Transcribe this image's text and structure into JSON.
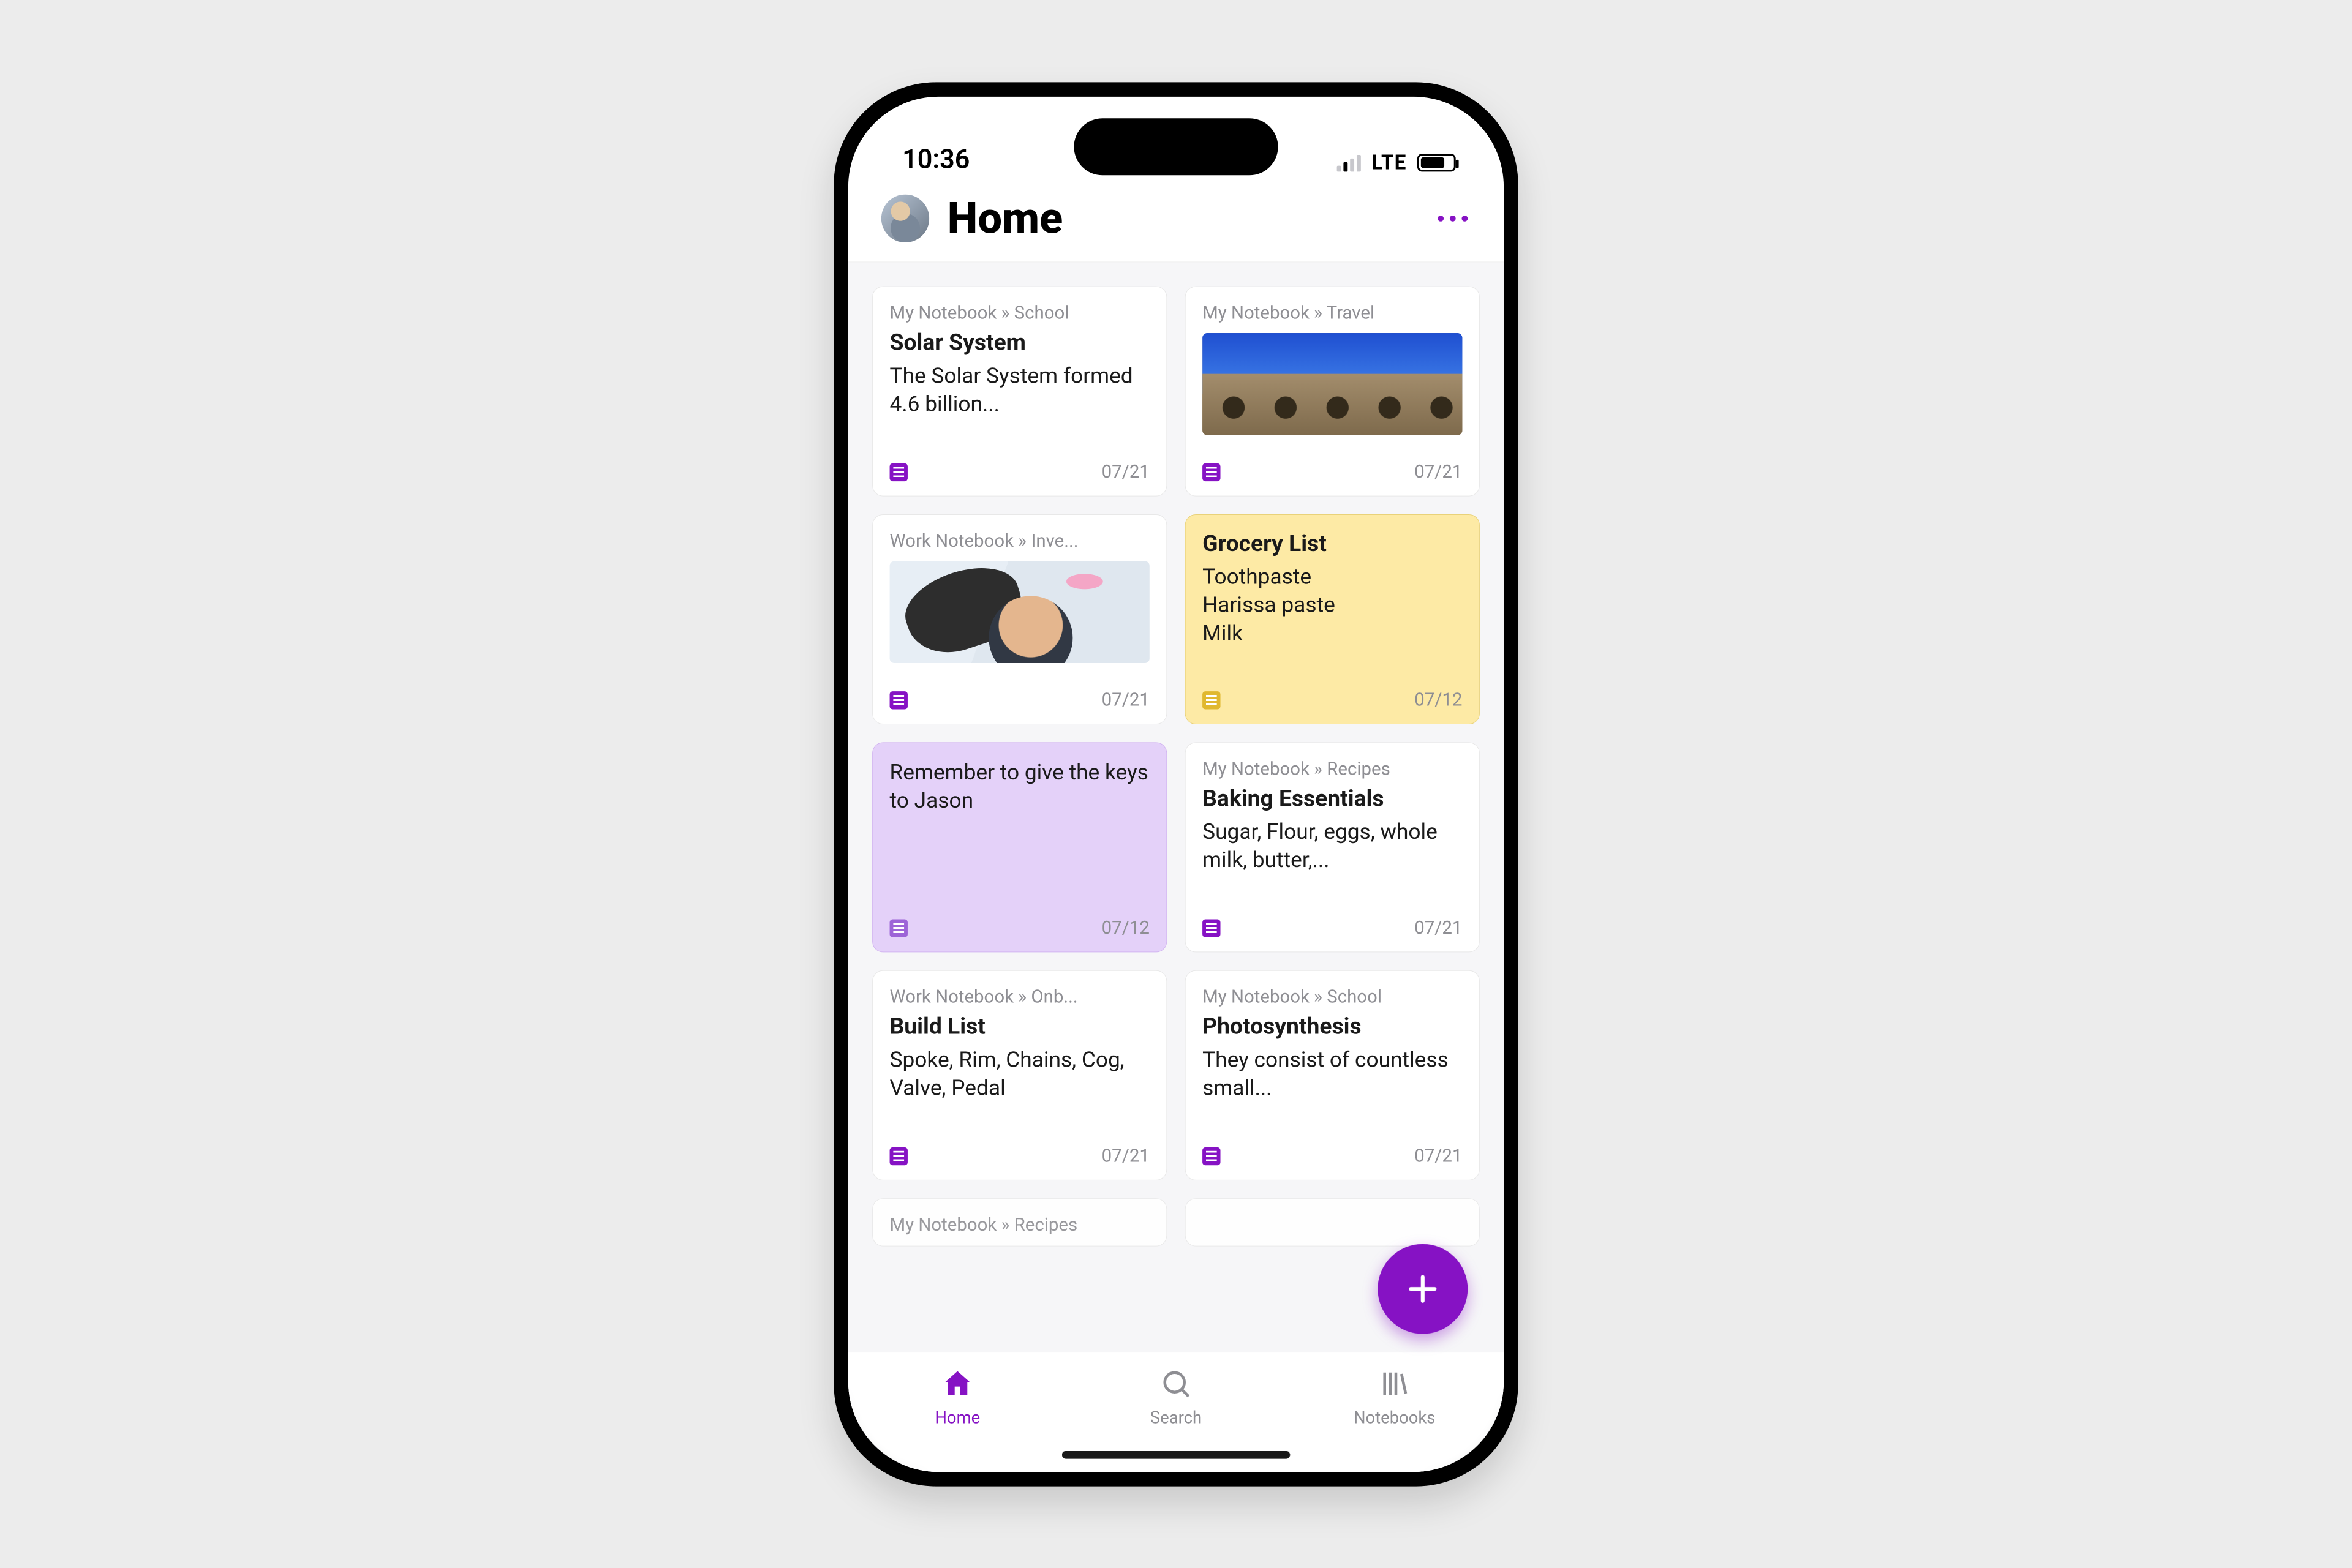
{
  "status": {
    "time": "10:36",
    "network": "LTE"
  },
  "header": {
    "title": "Home"
  },
  "accent_color": "#8612c4",
  "cards": [
    {
      "crumb": "My Notebook » School",
      "title": "Solar System",
      "excerpt": "The Solar System formed 4.6 billion...",
      "date": "07/21",
      "variant": "white",
      "thumb": ""
    },
    {
      "crumb": "My Notebook » Travel",
      "title": "",
      "excerpt": "",
      "date": "07/21",
      "variant": "white",
      "thumb": "colosseum"
    },
    {
      "crumb": "Work Notebook » Inve...",
      "title": "",
      "excerpt": "",
      "date": "07/21",
      "variant": "white",
      "thumb": "person"
    },
    {
      "crumb": "",
      "title": "Grocery List",
      "excerpt": "Toothpaste\nHarissa paste\nMilk",
      "date": "07/12",
      "variant": "yellow",
      "thumb": ""
    },
    {
      "crumb": "",
      "title": "",
      "excerpt": "Remember to give the keys to Jason",
      "date": "07/12",
      "variant": "purple",
      "thumb": ""
    },
    {
      "crumb": "My Notebook » Recipes",
      "title": "Baking Essentials",
      "excerpt": "Sugar, Flour, eggs, whole milk, butter,...",
      "date": "07/21",
      "variant": "white",
      "thumb": ""
    },
    {
      "crumb": "Work Notebook » Onb...",
      "title": "Build List",
      "excerpt": "Spoke, Rim, Chains, Cog, Valve, Pedal",
      "date": "07/21",
      "variant": "white",
      "thumb": ""
    },
    {
      "crumb": "My Notebook » School",
      "title": "Photosynthesis",
      "excerpt": "They consist of countless small...",
      "date": "07/21",
      "variant": "white",
      "thumb": ""
    },
    {
      "crumb": "My Notebook » Recipes",
      "title": "",
      "excerpt": "",
      "date": "",
      "variant": "white",
      "thumb": "",
      "peek": true
    },
    {
      "crumb": "",
      "title": "",
      "excerpt": "",
      "date": "",
      "variant": "white",
      "thumb": "",
      "peek": true
    }
  ],
  "tabs": [
    {
      "label": "Home",
      "icon": "home",
      "active": true
    },
    {
      "label": "Search",
      "icon": "search",
      "active": false
    },
    {
      "label": "Notebooks",
      "icon": "notebooks",
      "active": false
    }
  ]
}
